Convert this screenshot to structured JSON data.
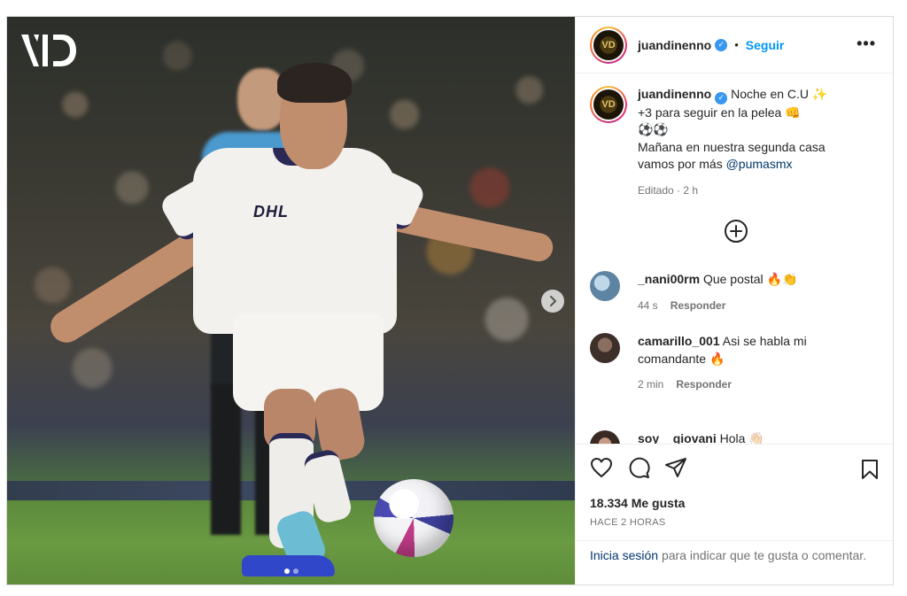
{
  "post": {
    "media": {
      "brand_logo": "VID",
      "jersey_sponsor": "DHL",
      "next_button": "chevron-right-icon",
      "carousel": {
        "slides": 2,
        "active": 1
      }
    },
    "header": {
      "username": "juandinenno",
      "follow_label": "Seguir",
      "separator": "•",
      "more_label": "•••"
    },
    "caption": {
      "username": "juandinenno",
      "line1": "Noche en C.U ✨",
      "line2": "+3 para seguir en la pelea 👊",
      "line3": "⚽⚽",
      "line4": "Mañana en nuestra segunda casa",
      "line5": "vamos por más",
      "mention": "@pumasmx",
      "meta": "Editado · 2 h"
    },
    "comments": [
      {
        "username": "_nani00rm",
        "text": "Que postal 🔥👏",
        "time": "44 s",
        "reply_label": "Responder",
        "avatar_color": "#6f8fa8"
      },
      {
        "username": "camarillo_001",
        "text": "Asi se habla mi comandante 🔥",
        "time": "2 min",
        "reply_label": "Responder",
        "avatar_color": "#5a4a42"
      },
      {
        "username": "soy__giovani",
        "text": "Hola 👋🏻",
        "time": "",
        "reply_label": "",
        "avatar_color": "#6a5044"
      }
    ],
    "actions": {
      "likes": "18.334 Me gusta",
      "timestamp": "HACE 2 HORAS",
      "login_link": "Inicia sesión",
      "login_text": "para indicar que te gusta o comentar."
    },
    "colors": {
      "accent": "#0095f6",
      "mention": "#00376b",
      "secondary_text": "#737373",
      "verified": "#3897f0"
    }
  }
}
